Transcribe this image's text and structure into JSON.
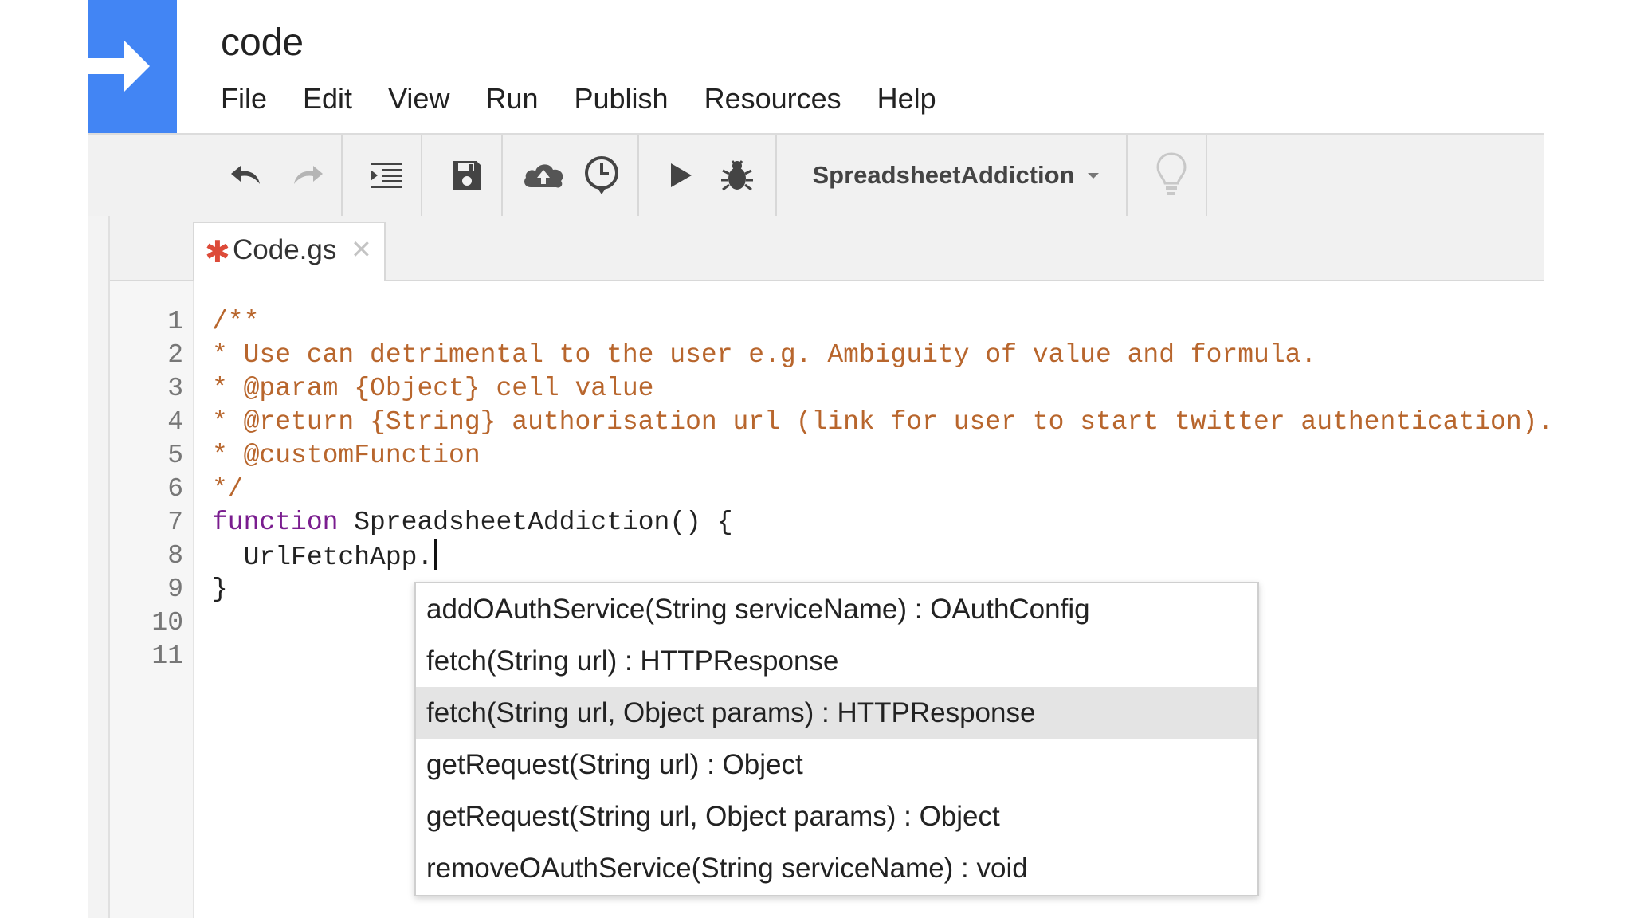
{
  "app": {
    "title": "code"
  },
  "menubar": [
    {
      "label": "File"
    },
    {
      "label": "Edit"
    },
    {
      "label": "View"
    },
    {
      "label": "Run"
    },
    {
      "label": "Publish"
    },
    {
      "label": "Resources"
    },
    {
      "label": "Help"
    }
  ],
  "toolbar": {
    "icons": [
      "undo-icon",
      "redo-icon",
      "indent-icon",
      "save-icon",
      "deploy-cloud-icon",
      "triggers-clock-icon",
      "run-play-icon",
      "debug-bug-icon",
      "lightbulb-icon"
    ],
    "function_select": {
      "selected": "SpreadsheetAddiction"
    }
  },
  "tabs": [
    {
      "label": "Code.gs",
      "unsaved_marker": "✱",
      "close": "✕"
    }
  ],
  "editor": {
    "line_numbers": [
      "1",
      "2",
      "3",
      "4",
      "5",
      "6",
      "7",
      "8",
      "9",
      "10",
      "11"
    ],
    "lines": [
      {
        "text": "/**",
        "kind": "comment"
      },
      {
        "text": "* Use can detrimental to the user e.g. Ambiguity of value and formula.",
        "kind": "comment"
      },
      {
        "text": "* @param {Object} cell value",
        "kind": "comment"
      },
      {
        "text": "* @return {String} authorisation url (link for user to start twitter authentication).",
        "kind": "comment"
      },
      {
        "text": "* @customFunction",
        "kind": "comment"
      },
      {
        "text": "*/",
        "kind": "comment"
      },
      {
        "keyword": "function",
        "rest": " SpreadsheetAddiction() {"
      },
      {
        "text": "  UrlFetchApp.",
        "kind": "code"
      },
      {
        "text": "}",
        "kind": "code"
      }
    ]
  },
  "autocomplete": {
    "items": [
      {
        "label": "addOAuthService(String serviceName) : OAuthConfig",
        "selected": false
      },
      {
        "label": "fetch(String url) : HTTPResponse",
        "selected": false
      },
      {
        "label": "fetch(String url, Object params) : HTTPResponse",
        "selected": true
      },
      {
        "label": "getRequest(String url) : Object",
        "selected": false
      },
      {
        "label": "getRequest(String url, Object params) : Object",
        "selected": false
      },
      {
        "label": "removeOAuthService(String serviceName) : void",
        "selected": false
      }
    ]
  },
  "colors": {
    "brand": "#4285f4",
    "comment": "#b8662d",
    "keyword": "#7a1d8f",
    "unsaved": "#dd4b39",
    "selection": "#e4e4e4"
  }
}
